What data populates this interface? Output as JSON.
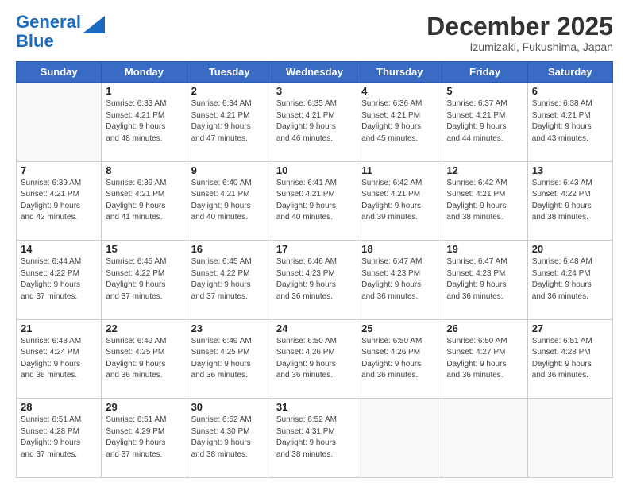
{
  "header": {
    "logo_line1": "General",
    "logo_line2": "Blue",
    "month": "December 2025",
    "location": "Izumizaki, Fukushima, Japan"
  },
  "days_of_week": [
    "Sunday",
    "Monday",
    "Tuesday",
    "Wednesday",
    "Thursday",
    "Friday",
    "Saturday"
  ],
  "weeks": [
    [
      {
        "day": "",
        "info": ""
      },
      {
        "day": "1",
        "info": "Sunrise: 6:33 AM\nSunset: 4:21 PM\nDaylight: 9 hours\nand 48 minutes."
      },
      {
        "day": "2",
        "info": "Sunrise: 6:34 AM\nSunset: 4:21 PM\nDaylight: 9 hours\nand 47 minutes."
      },
      {
        "day": "3",
        "info": "Sunrise: 6:35 AM\nSunset: 4:21 PM\nDaylight: 9 hours\nand 46 minutes."
      },
      {
        "day": "4",
        "info": "Sunrise: 6:36 AM\nSunset: 4:21 PM\nDaylight: 9 hours\nand 45 minutes."
      },
      {
        "day": "5",
        "info": "Sunrise: 6:37 AM\nSunset: 4:21 PM\nDaylight: 9 hours\nand 44 minutes."
      },
      {
        "day": "6",
        "info": "Sunrise: 6:38 AM\nSunset: 4:21 PM\nDaylight: 9 hours\nand 43 minutes."
      }
    ],
    [
      {
        "day": "7",
        "info": "Sunrise: 6:39 AM\nSunset: 4:21 PM\nDaylight: 9 hours\nand 42 minutes."
      },
      {
        "day": "8",
        "info": "Sunrise: 6:39 AM\nSunset: 4:21 PM\nDaylight: 9 hours\nand 41 minutes."
      },
      {
        "day": "9",
        "info": "Sunrise: 6:40 AM\nSunset: 4:21 PM\nDaylight: 9 hours\nand 40 minutes."
      },
      {
        "day": "10",
        "info": "Sunrise: 6:41 AM\nSunset: 4:21 PM\nDaylight: 9 hours\nand 40 minutes."
      },
      {
        "day": "11",
        "info": "Sunrise: 6:42 AM\nSunset: 4:21 PM\nDaylight: 9 hours\nand 39 minutes."
      },
      {
        "day": "12",
        "info": "Sunrise: 6:42 AM\nSunset: 4:21 PM\nDaylight: 9 hours\nand 38 minutes."
      },
      {
        "day": "13",
        "info": "Sunrise: 6:43 AM\nSunset: 4:22 PM\nDaylight: 9 hours\nand 38 minutes."
      }
    ],
    [
      {
        "day": "14",
        "info": "Sunrise: 6:44 AM\nSunset: 4:22 PM\nDaylight: 9 hours\nand 37 minutes."
      },
      {
        "day": "15",
        "info": "Sunrise: 6:45 AM\nSunset: 4:22 PM\nDaylight: 9 hours\nand 37 minutes."
      },
      {
        "day": "16",
        "info": "Sunrise: 6:45 AM\nSunset: 4:22 PM\nDaylight: 9 hours\nand 37 minutes."
      },
      {
        "day": "17",
        "info": "Sunrise: 6:46 AM\nSunset: 4:23 PM\nDaylight: 9 hours\nand 36 minutes."
      },
      {
        "day": "18",
        "info": "Sunrise: 6:47 AM\nSunset: 4:23 PM\nDaylight: 9 hours\nand 36 minutes."
      },
      {
        "day": "19",
        "info": "Sunrise: 6:47 AM\nSunset: 4:23 PM\nDaylight: 9 hours\nand 36 minutes."
      },
      {
        "day": "20",
        "info": "Sunrise: 6:48 AM\nSunset: 4:24 PM\nDaylight: 9 hours\nand 36 minutes."
      }
    ],
    [
      {
        "day": "21",
        "info": "Sunrise: 6:48 AM\nSunset: 4:24 PM\nDaylight: 9 hours\nand 36 minutes."
      },
      {
        "day": "22",
        "info": "Sunrise: 6:49 AM\nSunset: 4:25 PM\nDaylight: 9 hours\nand 36 minutes."
      },
      {
        "day": "23",
        "info": "Sunrise: 6:49 AM\nSunset: 4:25 PM\nDaylight: 9 hours\nand 36 minutes."
      },
      {
        "day": "24",
        "info": "Sunrise: 6:50 AM\nSunset: 4:26 PM\nDaylight: 9 hours\nand 36 minutes."
      },
      {
        "day": "25",
        "info": "Sunrise: 6:50 AM\nSunset: 4:26 PM\nDaylight: 9 hours\nand 36 minutes."
      },
      {
        "day": "26",
        "info": "Sunrise: 6:50 AM\nSunset: 4:27 PM\nDaylight: 9 hours\nand 36 minutes."
      },
      {
        "day": "27",
        "info": "Sunrise: 6:51 AM\nSunset: 4:28 PM\nDaylight: 9 hours\nand 36 minutes."
      }
    ],
    [
      {
        "day": "28",
        "info": "Sunrise: 6:51 AM\nSunset: 4:28 PM\nDaylight: 9 hours\nand 37 minutes."
      },
      {
        "day": "29",
        "info": "Sunrise: 6:51 AM\nSunset: 4:29 PM\nDaylight: 9 hours\nand 37 minutes."
      },
      {
        "day": "30",
        "info": "Sunrise: 6:52 AM\nSunset: 4:30 PM\nDaylight: 9 hours\nand 38 minutes."
      },
      {
        "day": "31",
        "info": "Sunrise: 6:52 AM\nSunset: 4:31 PM\nDaylight: 9 hours\nand 38 minutes."
      },
      {
        "day": "",
        "info": ""
      },
      {
        "day": "",
        "info": ""
      },
      {
        "day": "",
        "info": ""
      }
    ]
  ]
}
